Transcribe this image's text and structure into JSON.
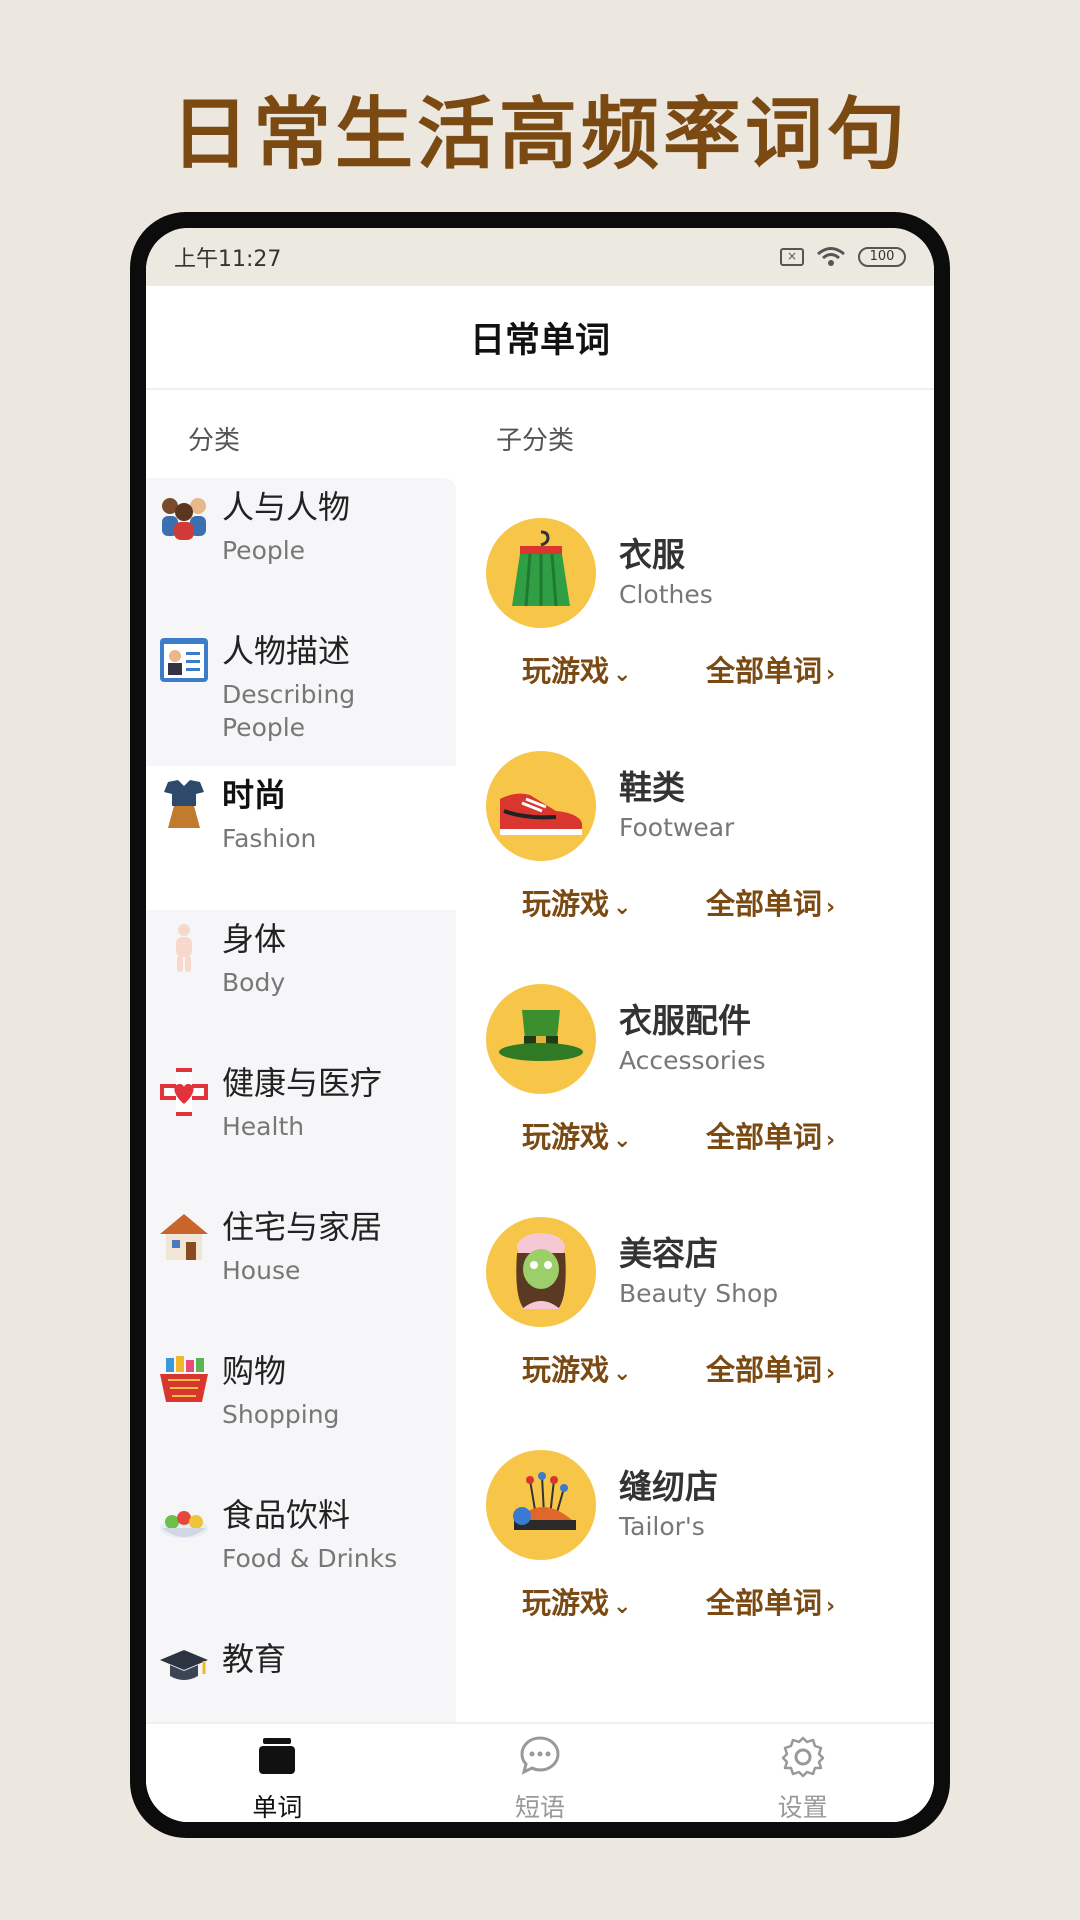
{
  "promo_title": "日常生活高频率词句",
  "status_bar": {
    "time": "上午11:27",
    "battery": "100",
    "sim": "×"
  },
  "header": {
    "title": "日常单词"
  },
  "columns": {
    "category": "分类",
    "subcategory": "子分类"
  },
  "categories": [
    {
      "zh": "人与人物",
      "en": "People",
      "icon": "people-icon"
    },
    {
      "zh": "人物描述",
      "en": "Describing People",
      "icon": "profile-card-icon"
    },
    {
      "zh": "时尚",
      "en": "Fashion",
      "icon": "fashion-icon",
      "selected": true
    },
    {
      "zh": "身体",
      "en": "Body",
      "icon": "body-icon"
    },
    {
      "zh": "健康与医疗",
      "en": "Health",
      "icon": "health-icon"
    },
    {
      "zh": "住宅与家居",
      "en": "House",
      "icon": "house-icon"
    },
    {
      "zh": "购物",
      "en": "Shopping",
      "icon": "shopping-basket-icon"
    },
    {
      "zh": "食品饮料",
      "en": "Food & Drinks",
      "icon": "food-icon"
    },
    {
      "zh": "教育",
      "en": "",
      "icon": "graduation-cap-icon"
    }
  ],
  "subcategories": [
    {
      "zh": "衣服",
      "en": "Clothes",
      "icon": "skirt-icon"
    },
    {
      "zh": "鞋类",
      "en": "Footwear",
      "icon": "sneaker-icon"
    },
    {
      "zh": "衣服配件",
      "en": "Accessories",
      "icon": "hat-icon"
    },
    {
      "zh": "美容店",
      "en": "Beauty Shop",
      "icon": "face-mask-icon"
    },
    {
      "zh": "缝纫店",
      "en": "Tailor's",
      "icon": "pincushion-icon"
    }
  ],
  "sub_actions": {
    "play": "玩游戏",
    "all_words": "全部单词"
  },
  "tabs": [
    {
      "label": "单词",
      "icon": "cards-icon",
      "active": true
    },
    {
      "label": "短语",
      "icon": "chat-bubble-icon"
    },
    {
      "label": "设置",
      "icon": "gear-icon"
    }
  ],
  "colors": {
    "brand": "#7b4a12",
    "accent_circle": "#f7c547",
    "background": "#ece8e0"
  }
}
